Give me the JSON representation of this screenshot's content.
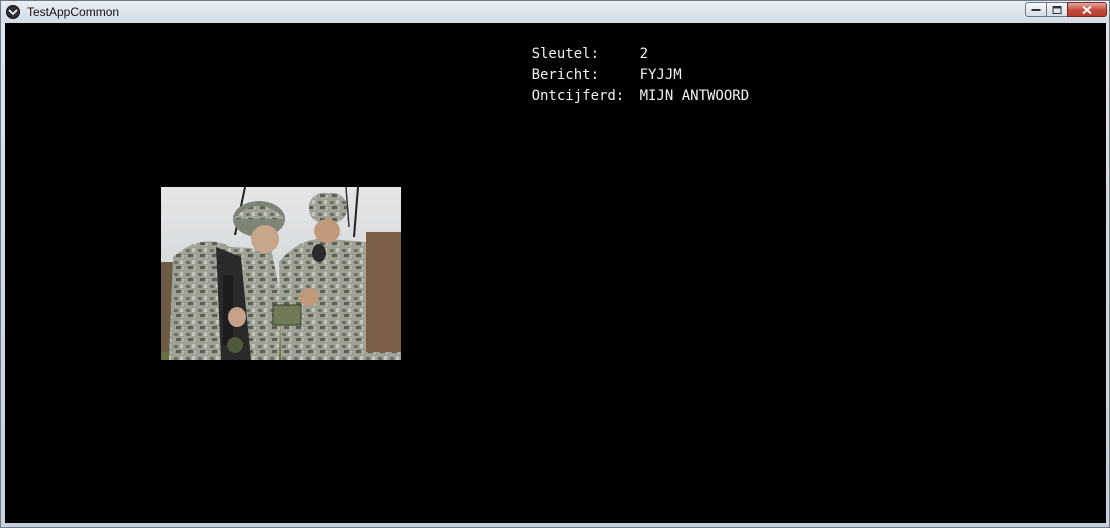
{
  "window": {
    "title": "TestAppCommon",
    "icon": "app-logo-icon",
    "controls": {
      "minimize": "minimize-icon",
      "maximize": "maximize-icon",
      "close": "close-icon"
    }
  },
  "info": {
    "key_label": "Sleutel:",
    "key_value": "2",
    "message_label": "Bericht:",
    "message_value": "FYJJM",
    "decrypted_label": "Ontcijferd:",
    "decrypted_value": "MIJN ANTWOORD"
  },
  "photo": {
    "alt": "soldiers-with-radio-photo"
  },
  "colors": {
    "client_background": "#000000",
    "text": "#f2f2f2",
    "close_button": "#c44a3a"
  }
}
